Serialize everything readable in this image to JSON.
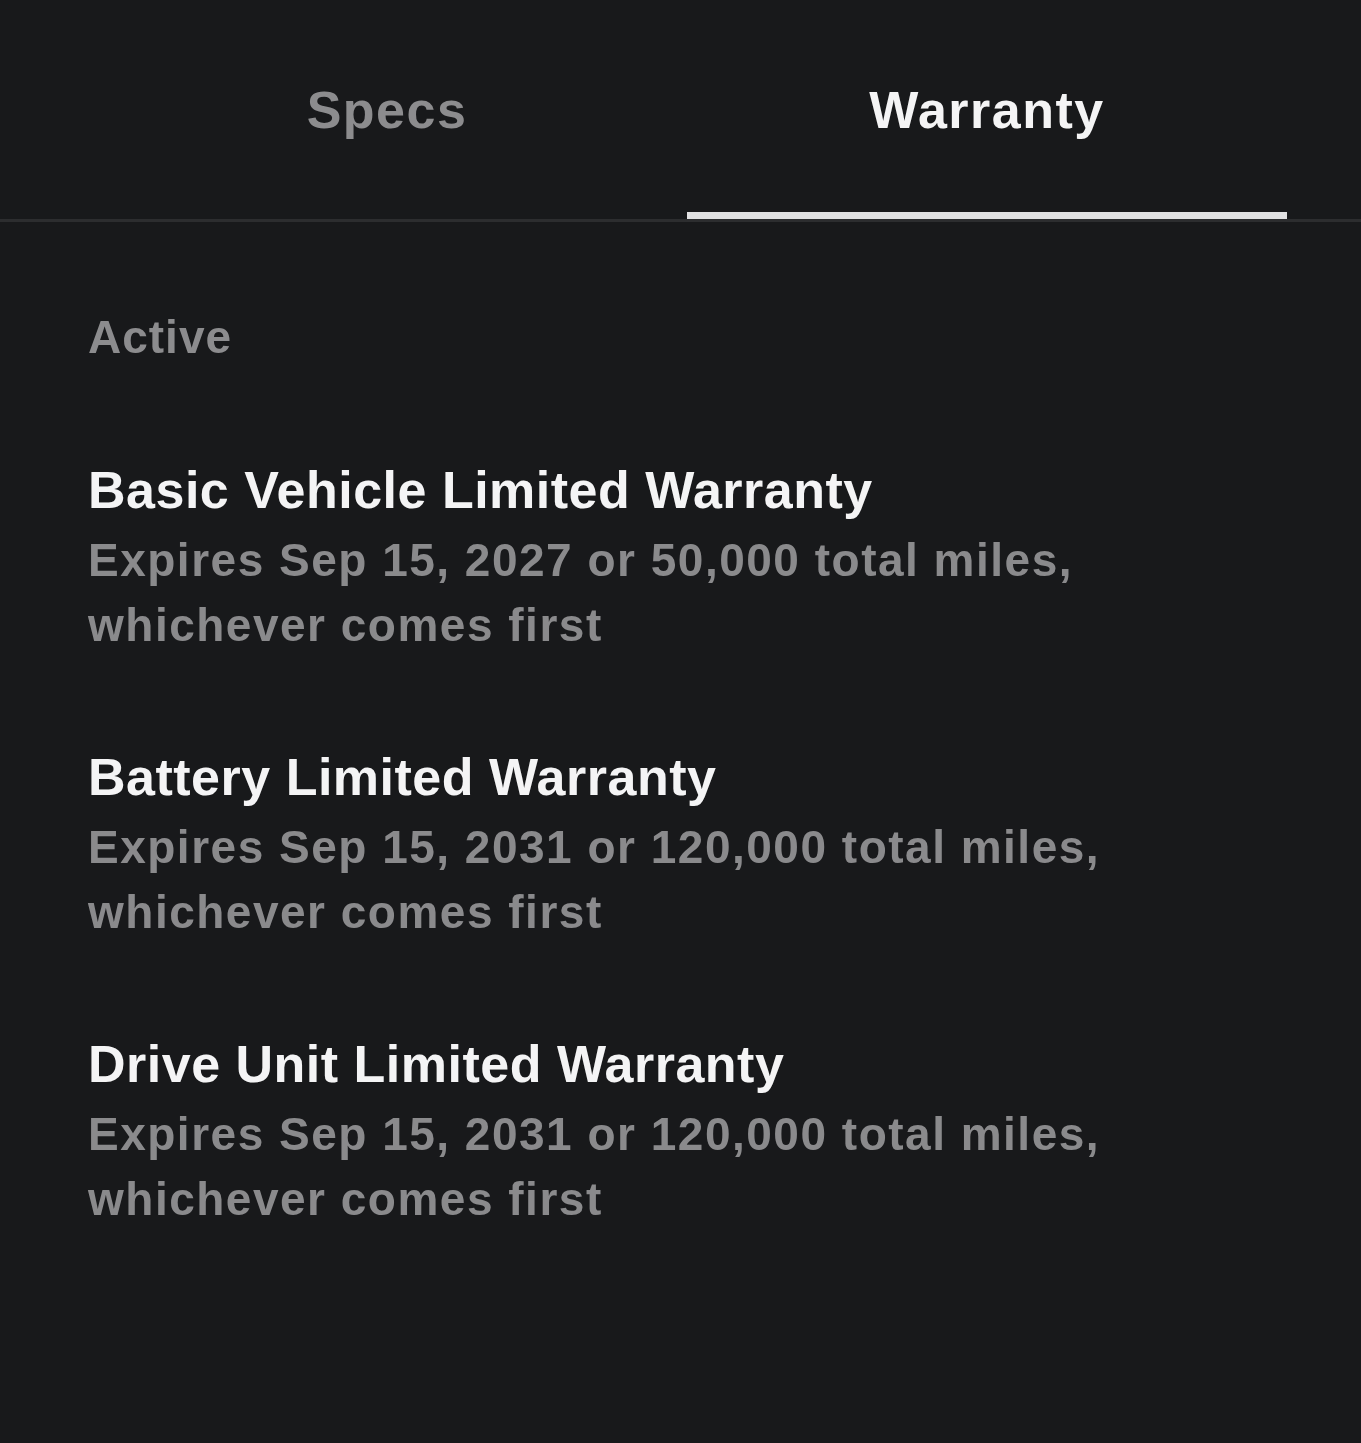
{
  "tabs": [
    {
      "label": "Specs",
      "selected": false
    },
    {
      "label": "Warranty",
      "selected": true
    }
  ],
  "section": {
    "heading": "Active"
  },
  "warranties": [
    {
      "title": "Basic Vehicle Limited Warranty",
      "details": "Expires Sep 15, 2027 or 50,000 total miles, whichever comes first"
    },
    {
      "title": "Battery Limited Warranty",
      "details": "Expires Sep 15, 2031 or 120,000 total miles, whichever comes first"
    },
    {
      "title": "Drive Unit Limited Warranty",
      "details": "Expires Sep 15, 2031 or 120,000 total miles, whichever comes first"
    }
  ]
}
